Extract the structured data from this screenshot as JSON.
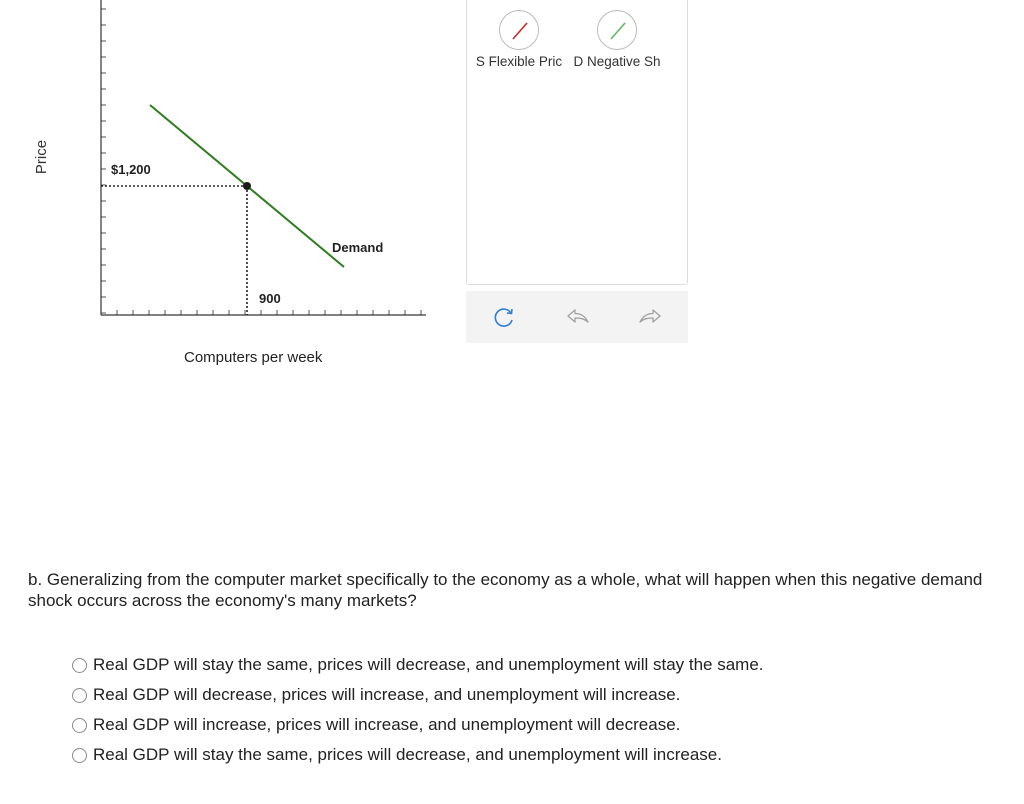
{
  "graph": {
    "y_axis_label": "Price",
    "x_axis_label": "Computers per week",
    "price_label": "$1,200",
    "quantity_label": "900",
    "curve_label": "Demand",
    "curve_color": "#2e7d1f"
  },
  "tools": [
    {
      "label": "S Flexible Pric",
      "icon": "supply-line-icon",
      "color": "#c62828"
    },
    {
      "label": "D Negative Sh",
      "icon": "demand-line-icon",
      "color": "#5cb85c"
    }
  ],
  "actions": {
    "reset": "reset-icon",
    "undo": "undo-icon",
    "redo": "redo-icon"
  },
  "question": {
    "text": "b. Generalizing from the computer market specifically to the economy as a whole, what will happen when this negative demand shock occurs across the economy's many markets?",
    "options": [
      "Real GDP will stay the same, prices will decrease, and unemployment will stay the same.",
      "Real GDP will decrease, prices will increase, and unemployment will increase.",
      "Real GDP will increase, prices will increase, and unemployment will decrease.",
      "Real GDP will stay the same, prices will decrease, and unemployment will increase."
    ]
  }
}
